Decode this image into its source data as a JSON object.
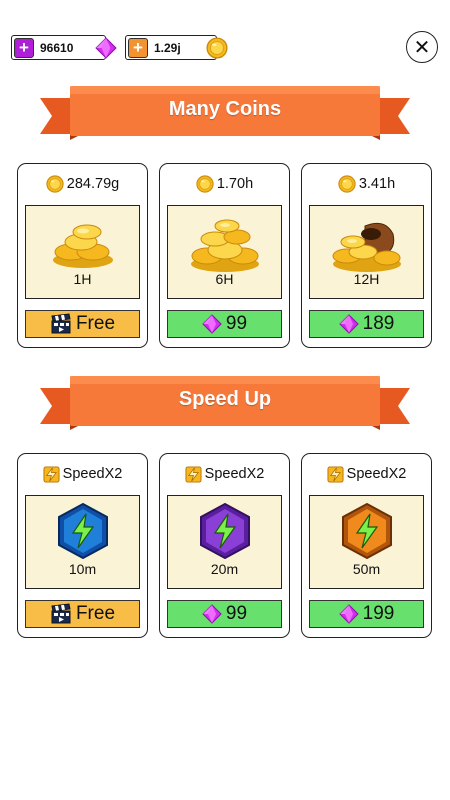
{
  "topbar": {
    "gems": {
      "value": "96610",
      "icon": "gem-icon"
    },
    "coins": {
      "value": "1.29j",
      "icon": "coin-icon"
    },
    "close_label": "✕"
  },
  "sections": [
    {
      "title": "Many Coins",
      "items": [
        {
          "amount": "284.79g",
          "duration": "1H",
          "price": "Free",
          "price_type": "ad"
        },
        {
          "amount": "1.70h",
          "duration": "6H",
          "price": "99",
          "price_type": "gem"
        },
        {
          "amount": "3.41h",
          "duration": "12H",
          "price": "189",
          "price_type": "gem"
        }
      ]
    },
    {
      "title": "Speed Up",
      "items": [
        {
          "amount": "SpeedX2",
          "duration": "10m",
          "price": "Free",
          "price_type": "ad",
          "badge_color": "#1f7fd9"
        },
        {
          "amount": "SpeedX2",
          "duration": "20m",
          "price": "99",
          "price_type": "gem",
          "badge_color": "#8a3fd6"
        },
        {
          "amount": "SpeedX2",
          "duration": "50m",
          "price": "199",
          "price_type": "gem",
          "badge_color": "#f08a1c"
        }
      ]
    }
  ],
  "colors": {
    "ribbon": "#f7793a",
    "free_button": "#f8bd47",
    "gem_button": "#67e06e",
    "card_image_bg": "#fbf3d5",
    "gem": "#d32ef0",
    "coin": "#f7c325"
  }
}
